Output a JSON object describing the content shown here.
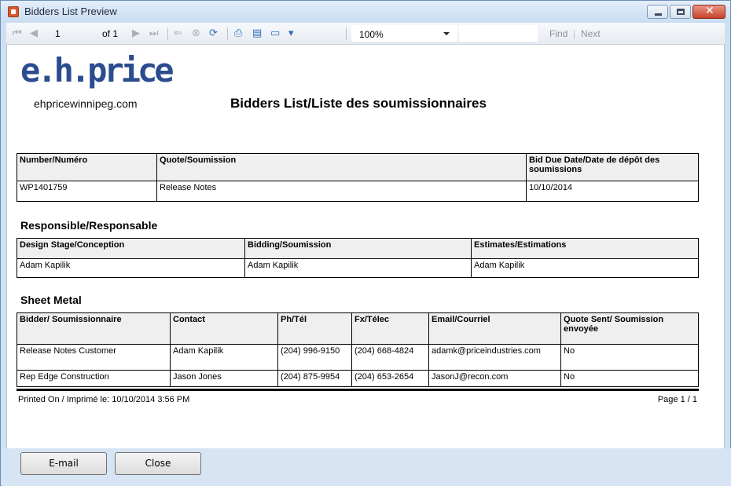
{
  "window": {
    "title": "Bidders List Preview"
  },
  "toolbar": {
    "page": "1",
    "of_label": "of 1",
    "zoom": "100%",
    "find_label": "Find",
    "next_label": "Next"
  },
  "report": {
    "logo": "e.h.price",
    "website": "ehpricewinnipeg.com",
    "title": "Bidders List/Liste des soumissionnaires",
    "quote_table": {
      "headers": [
        "Number/Numéro",
        "Quote/Soumission",
        "Bid Due Date/Date de dépôt des soumissions"
      ],
      "row": [
        "WP1401759",
        "Release Notes",
        "10/10/2014"
      ]
    },
    "responsible_heading": "Responsible/Responsable",
    "responsible_table": {
      "headers": [
        "Design Stage/Conception",
        "Bidding/Soumission",
        "Estimates/Estimations"
      ],
      "row": [
        "Adam Kapilik",
        "Adam Kapilik",
        "Adam Kapilik"
      ]
    },
    "sheet_metal_heading": "Sheet Metal",
    "bidders_table": {
      "headers": [
        "Bidder/ Soumissionnaire",
        "Contact",
        "Ph/Tél",
        "Fx/Télec",
        "Email/Courriel",
        "Quote Sent/ Soumission envoyée"
      ],
      "rows": [
        [
          "Release Notes Customer",
          "Adam Kapilik",
          "(204) 996-9150",
          "(204) 668-4824",
          "adamk@priceindustries.com",
          "No"
        ],
        [
          "Rep Edge Construction",
          "Jason Jones",
          "(204) 875-9954",
          "(204) 653-2654",
          "JasonJ@recon.com",
          "No"
        ]
      ]
    },
    "printed_on": "Printed On / Imprimé le: 10/10/2014 3:56 PM",
    "page_number": "Page 1 / 1"
  },
  "buttons": {
    "email": "E-mail",
    "close": "Close"
  },
  "colors": {
    "logo": "#2b4d8f",
    "titlebar": "#c9dcf1",
    "close_button": "#c6432c"
  }
}
